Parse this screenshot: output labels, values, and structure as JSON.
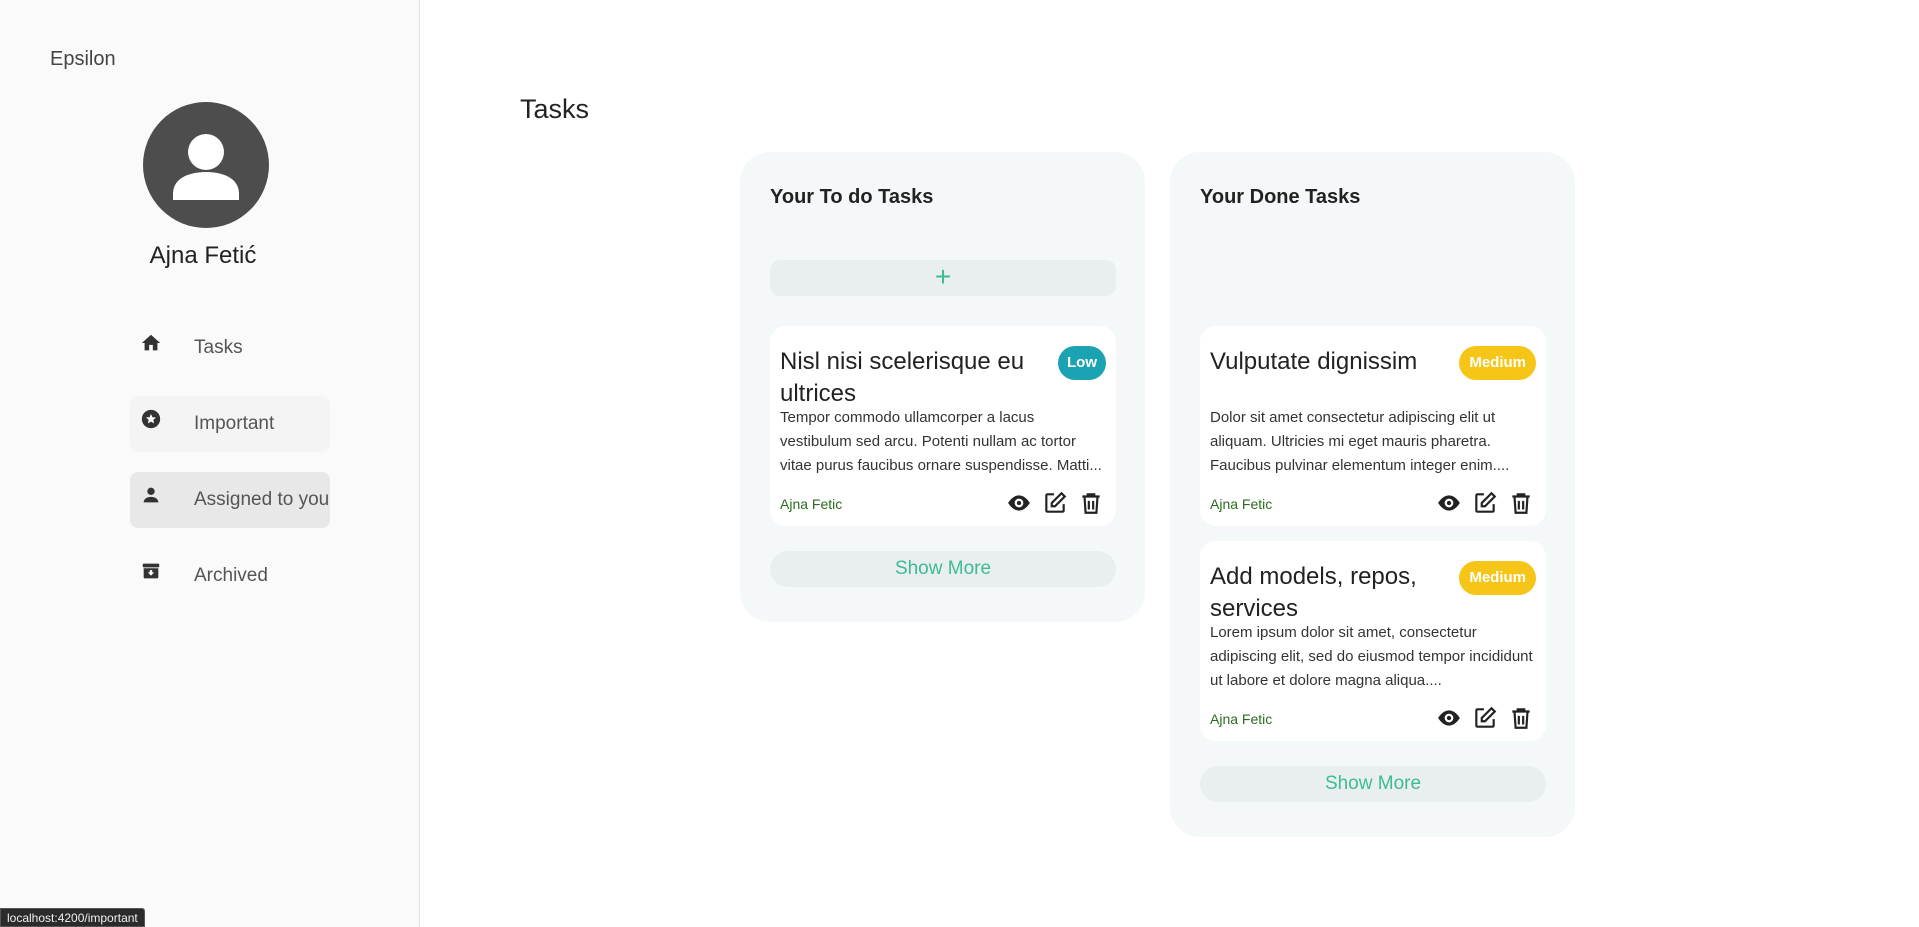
{
  "app": {
    "brand": "Epsilon",
    "user_name": "Ajna Fetić",
    "status_url": "localhost:4200/important"
  },
  "sidebar": {
    "items": [
      {
        "label": "Tasks",
        "icon": "home-icon",
        "active": false
      },
      {
        "label": "Important",
        "icon": "star-icon",
        "active": false
      },
      {
        "label": "Assigned to you",
        "icon": "person-icon",
        "active": true
      },
      {
        "label": "Archived",
        "icon": "archive-icon",
        "active": false
      }
    ]
  },
  "main": {
    "title": "Tasks",
    "todo": {
      "heading": "Your To do Tasks",
      "add_label": "+",
      "show_more": "Show More",
      "tasks": [
        {
          "title": "Nisl nisi scelerisque eu ultrices",
          "priority": "Low",
          "description": "Tempor commodo ullamcorper a lacus vestibulum sed arcu. Potenti nullam ac tortor vitae purus faucibus ornare suspendisse. Matti...",
          "author": "Ajna Fetic"
        }
      ]
    },
    "done": {
      "heading": "Your Done Tasks",
      "show_more": "Show More",
      "tasks": [
        {
          "title": "Vulputate dignissim",
          "priority": "Medium",
          "description": "Dolor sit amet consectetur adipiscing elit ut aliquam. Ultricies mi eget mauris pharetra. Faucibus pulvinar elementum integer enim....",
          "author": "Ajna Fetic"
        },
        {
          "title": "Add models, repos, services",
          "priority": "Medium",
          "description": "Lorem ipsum dolor sit amet, consectetur adipiscing elit, sed do eiusmod tempor incididunt ut labore et dolore magna aliqua....",
          "author": "Ajna Fetic"
        }
      ]
    }
  },
  "colors": {
    "accent": "#3dbb95",
    "low": "#1ba3b3",
    "medium": "#f5c518",
    "author": "#2b6b1f"
  }
}
